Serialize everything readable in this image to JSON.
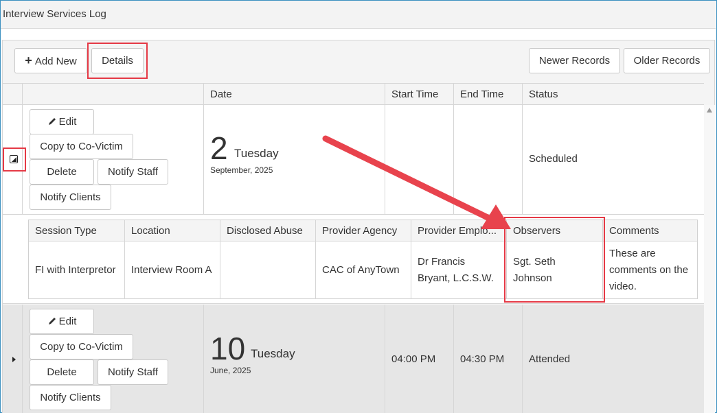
{
  "window": {
    "title": "Interview Services Log"
  },
  "toolbar": {
    "add_new_icon": "+",
    "add_new_label": "Add New",
    "details_label": "Details",
    "newer_label": "Newer Records",
    "older_label": "Older Records"
  },
  "columns": {
    "date": "Date",
    "start": "Start Time",
    "end": "End Time",
    "status": "Status"
  },
  "records": [
    {
      "actions": {
        "edit": "Edit",
        "copy": "Copy to Co-Victim",
        "delete": "Delete",
        "notify_staff": "Notify Staff",
        "notify_clients": "Notify Clients"
      },
      "day": "2",
      "weekday": "Tuesday",
      "month_year": "September, 2025",
      "start_time": "",
      "end_time": "",
      "status": "Scheduled",
      "expanded": true
    },
    {
      "actions": {
        "edit": "Edit",
        "copy": "Copy to Co-Victim",
        "delete": "Delete",
        "notify_staff": "Notify Staff",
        "notify_clients": "Notify Clients"
      },
      "day": "10",
      "weekday": "Tuesday",
      "month_year": "June, 2025",
      "start_time": "04:00 PM",
      "end_time": "04:30 PM",
      "status": "Attended",
      "expanded": false
    }
  ],
  "details": {
    "headers": {
      "session_type": "Session Type",
      "location": "Location",
      "disclosed_abuse": "Disclosed Abuse",
      "provider_agency": "Provider Agency",
      "provider_employee": "Provider Emplo...",
      "observers": "Observers",
      "comments": "Comments"
    },
    "row": {
      "session_type": "FI with Interpretor",
      "location": "Interview Room A",
      "disclosed_abuse": "",
      "provider_agency": "CAC of AnyTown",
      "provider_employee_line1": "Dr Francis",
      "provider_employee_line2": "Bryant, L.C.S.W.",
      "observers_line1": "Sgt. Seth",
      "observers_line2": "Johnson",
      "comments_line1": "These are",
      "comments_line2": "comments on the",
      "comments_line3": "video."
    }
  },
  "colors": {
    "highlight": "#e53945",
    "arrow": "#e8434d",
    "row_alt": "#e6e6e6"
  },
  "icons": {
    "edit": "pencil-icon",
    "expand": "expand-toggle-icon",
    "collapse": "collapse-toggle-icon"
  }
}
